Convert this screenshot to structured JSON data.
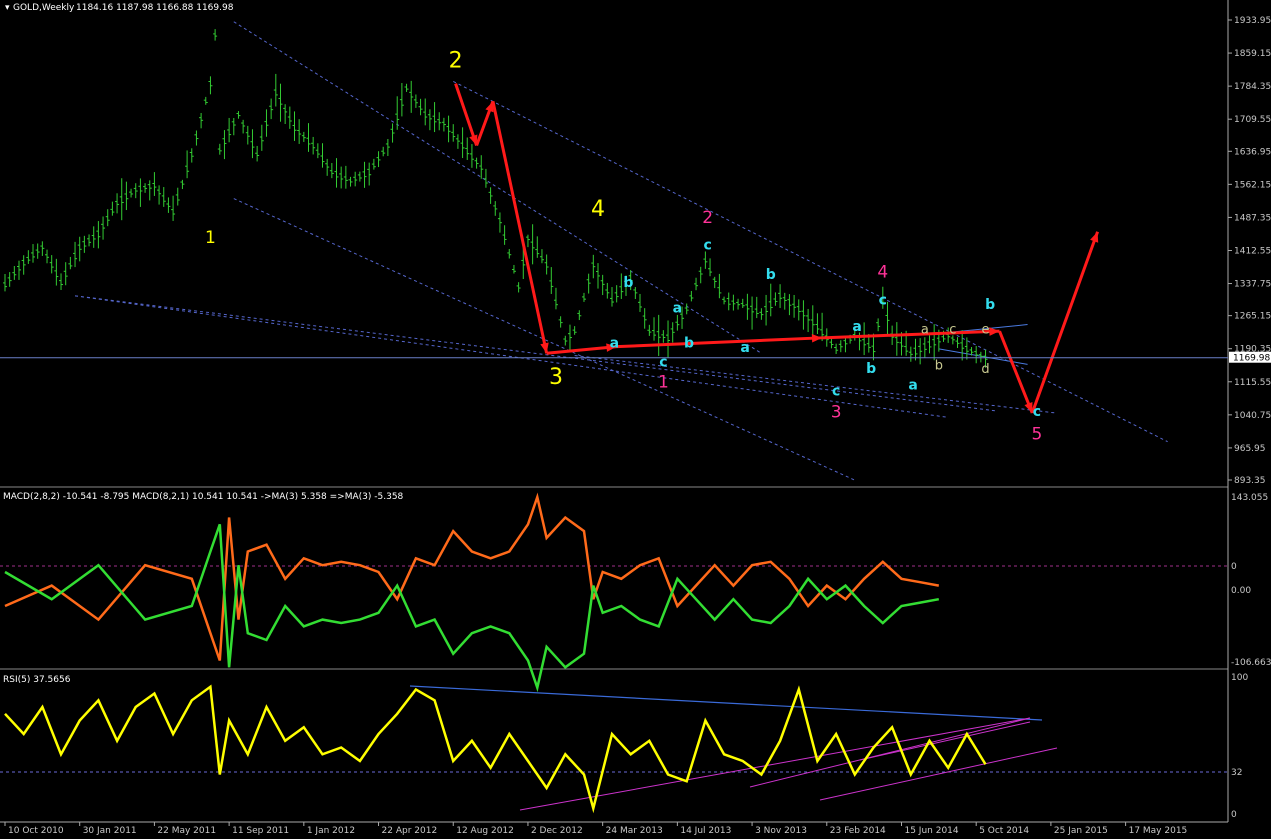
{
  "main_panel": {
    "symbol_header": "GOLD,Weekly",
    "ohlc": "1184.16 1187.98 1166.88 1169.98",
    "current_price": "1169.98",
    "y_ticks": [
      "1933.95",
      "1859.15",
      "1784.35",
      "1709.55",
      "1636.95",
      "1562.15",
      "1487.35",
      "1412.55",
      "1337.75",
      "1265.15",
      "1190.35",
      "1115.55",
      "1040.75",
      "965.95",
      "893.35"
    ]
  },
  "macd_panel": {
    "header": "MACD(2,8,2) -10.541 -8.795  MACD(8,2,1) 10.541 10.541  ->MA(3) 5.358  =>MA(3) -5.358",
    "y_ticks": [
      "143.055",
      "0",
      "0.00",
      "-106.663"
    ]
  },
  "rsi_panel": {
    "header": "RSI(5) 37.5656",
    "y_ticks": [
      "100",
      "32",
      "0"
    ]
  },
  "x_dates": [
    "10 Oct 2010",
    "30 Jan 2011",
    "22 May 2011",
    "11 Sep 2011",
    "1 Jan 2012",
    "22 Apr 2012",
    "12 Aug 2012",
    "2 Dec 2012",
    "24 Mar 2013",
    "14 Jul 2013",
    "3 Nov 2013",
    "23 Feb 2014",
    "15 Jun 2014",
    "5 Oct 2014",
    "25 Jan 2015",
    "17 May 2015"
  ],
  "wave_labels": [
    {
      "t": "2",
      "c": "#ffff00",
      "s": "lg",
      "x": 96.5,
      "y": 1827
    },
    {
      "t": "1",
      "c": "#ffff00",
      "s": "md",
      "x": 44,
      "y": 1430
    },
    {
      "t": "4",
      "c": "#ffff00",
      "s": "lg",
      "x": 127,
      "y": 1490
    },
    {
      "t": "3",
      "c": "#ffff00",
      "s": "lg",
      "x": 118,
      "y": 1110
    },
    {
      "t": "2",
      "c": "#ff3399",
      "s": "md",
      "x": 150.5,
      "y": 1475
    },
    {
      "t": "c",
      "c": "#33ddee",
      "s": "sm",
      "x": 150.5,
      "y": 1415
    },
    {
      "t": "b",
      "c": "#33ddee",
      "s": "sm",
      "x": 133.5,
      "y": 1330
    },
    {
      "t": "a",
      "c": "#33ddee",
      "s": "sm",
      "x": 144,
      "y": 1272
    },
    {
      "t": "a",
      "c": "#33ddee",
      "s": "sm",
      "x": 130.5,
      "y": 1193
    },
    {
      "t": "b",
      "c": "#33ddee",
      "s": "sm",
      "x": 146.5,
      "y": 1193
    },
    {
      "t": "a",
      "c": "#33ddee",
      "s": "sm",
      "x": 158.5,
      "y": 1183
    },
    {
      "t": "c",
      "c": "#33ddee",
      "s": "sm",
      "x": 141,
      "y": 1150
    },
    {
      "t": "1",
      "c": "#ff3399",
      "s": "md",
      "x": 141,
      "y": 1103
    },
    {
      "t": "b",
      "c": "#33ddee",
      "s": "sm",
      "x": 164,
      "y": 1348
    },
    {
      "t": "4",
      "c": "#ff3399",
      "s": "md",
      "x": 188,
      "y": 1352
    },
    {
      "t": "c",
      "c": "#33ddee",
      "s": "sm",
      "x": 188,
      "y": 1290
    },
    {
      "t": "a",
      "c": "#33ddee",
      "s": "sm",
      "x": 182.5,
      "y": 1230
    },
    {
      "t": "b",
      "c": "#33ddee",
      "s": "sm",
      "x": 185.5,
      "y": 1135
    },
    {
      "t": "c",
      "c": "#33ddee",
      "s": "sm",
      "x": 178,
      "y": 1085
    },
    {
      "t": "3",
      "c": "#ff3399",
      "s": "md",
      "x": 178,
      "y": 1035
    },
    {
      "t": "a",
      "c": "#33ddee",
      "s": "sm",
      "x": 194.5,
      "y": 1098
    },
    {
      "t": "a",
      "c": "#c8c890",
      "s": "xs",
      "x": 197,
      "y": 1225
    },
    {
      "t": "c",
      "c": "#c8c890",
      "s": "xs",
      "x": 203,
      "y": 1225
    },
    {
      "t": "e",
      "c": "#c8c890",
      "s": "xs",
      "x": 210,
      "y": 1225
    },
    {
      "t": "b",
      "c": "#c8c890",
      "s": "xs",
      "x": 200,
      "y": 1143
    },
    {
      "t": "d",
      "c": "#c8c890",
      "s": "xs",
      "x": 210,
      "y": 1135
    },
    {
      "t": "b",
      "c": "#33ddee",
      "s": "sm",
      "x": 211,
      "y": 1280
    },
    {
      "t": "c",
      "c": "#33ddee",
      "s": "sm",
      "x": 221,
      "y": 1038
    },
    {
      "t": "5",
      "c": "#ff3399",
      "s": "md",
      "x": 221,
      "y": 985
    }
  ],
  "chart_data": {
    "type": "line",
    "title": "GOLD,Weekly",
    "x_unit": "weeks since 10 Oct 2010",
    "price_series": [
      [
        0,
        1335
      ],
      [
        4,
        1385
      ],
      [
        8,
        1420
      ],
      [
        12,
        1340
      ],
      [
        16,
        1420
      ],
      [
        20,
        1450
      ],
      [
        24,
        1520
      ],
      [
        28,
        1550
      ],
      [
        32,
        1560
      ],
      [
        36,
        1500
      ],
      [
        40,
        1630
      ],
      [
        44,
        1790
      ],
      [
        45,
        1900
      ],
      [
        46,
        1640
      ],
      [
        50,
        1720
      ],
      [
        54,
        1630
      ],
      [
        58,
        1770
      ],
      [
        62,
        1690
      ],
      [
        66,
        1650
      ],
      [
        70,
        1590
      ],
      [
        74,
        1570
      ],
      [
        78,
        1590
      ],
      [
        82,
        1650
      ],
      [
        86,
        1780
      ],
      [
        90,
        1720
      ],
      [
        94,
        1700
      ],
      [
        98,
        1650
      ],
      [
        102,
        1600
      ],
      [
        106,
        1480
      ],
      [
        110,
        1330
      ],
      [
        112,
        1440
      ],
      [
        116,
        1380
      ],
      [
        120,
        1210
      ],
      [
        122,
        1230
      ],
      [
        126,
        1380
      ],
      [
        130,
        1300
      ],
      [
        134,
        1350
      ],
      [
        138,
        1230
      ],
      [
        142,
        1215
      ],
      [
        146,
        1280
      ],
      [
        150,
        1390
      ],
      [
        154,
        1300
      ],
      [
        158,
        1290
      ],
      [
        162,
        1270
      ],
      [
        166,
        1310
      ],
      [
        170,
        1280
      ],
      [
        174,
        1240
      ],
      [
        178,
        1190
      ],
      [
        182,
        1220
      ],
      [
        186,
        1190
      ],
      [
        188,
        1300
      ],
      [
        190,
        1220
      ],
      [
        194,
        1180
      ],
      [
        198,
        1200
      ],
      [
        202,
        1220
      ],
      [
        206,
        1190
      ],
      [
        210,
        1170
      ]
    ],
    "price_labels": [
      {
        "x": 0,
        "text": "10 Oct 2010"
      },
      {
        "x": 16,
        "text": "30 Jan 2011"
      },
      {
        "x": 32,
        "text": "22 May 2011"
      },
      {
        "x": 48,
        "text": "11 Sep 2011"
      },
      {
        "x": 64,
        "text": "1 Jan 2012"
      },
      {
        "x": 80,
        "text": "22 Apr 2012"
      },
      {
        "x": 96,
        "text": "12 Aug 2012"
      },
      {
        "x": 112,
        "text": "2 Dec 2012"
      },
      {
        "x": 128,
        "text": "24 Mar 2013"
      },
      {
        "x": 144,
        "text": "14 Jul 2013"
      },
      {
        "x": 160,
        "text": "3 Nov 2013"
      },
      {
        "x": 176,
        "text": "23 Feb 2014"
      },
      {
        "x": 192,
        "text": "15 Jun 2014"
      },
      {
        "x": 208,
        "text": "5 Oct 2014"
      },
      {
        "x": 224,
        "text": "25 Jan 2015"
      },
      {
        "x": 240,
        "text": "17 May 2015"
      }
    ],
    "y_range": [
      893.35,
      1933.95
    ],
    "wave_path": [
      [
        96.5,
        1790
      ],
      [
        101,
        1650
      ],
      [
        104.5,
        1750
      ],
      [
        116,
        1180
      ],
      [
        131,
        1195
      ],
      [
        175,
        1215
      ],
      [
        213,
        1230
      ],
      [
        220,
        1045
      ],
      [
        234,
        1455
      ]
    ],
    "trendlines_price": [
      [
        [
          49,
          1930
        ],
        [
          162,
          1180
        ]
      ],
      [
        [
          96,
          1795
        ],
        [
          249,
          980
        ]
      ],
      [
        [
          49,
          1530
        ],
        [
          182,
          893
        ]
      ],
      [
        [
          15,
          1310
        ],
        [
          212,
          1050
        ]
      ],
      [
        [
          15,
          1310
        ],
        [
          202,
          1035
        ]
      ],
      [
        [
          122,
          1175
        ],
        [
          225,
          1045
        ]
      ],
      [
        [
          200,
          1225
        ],
        [
          219,
          1245
        ]
      ],
      [
        [
          200,
          1190
        ],
        [
          219,
          1155
        ]
      ]
    ],
    "macd_range": [
      -106.663,
      143.055
    ],
    "macd_orange": [
      [
        0,
        -20
      ],
      [
        10,
        10
      ],
      [
        20,
        -40
      ],
      [
        30,
        40
      ],
      [
        40,
        20
      ],
      [
        44,
        -60
      ],
      [
        46,
        -100
      ],
      [
        48,
        110
      ],
      [
        50,
        -40
      ],
      [
        52,
        60
      ],
      [
        56,
        70
      ],
      [
        60,
        20
      ],
      [
        64,
        50
      ],
      [
        68,
        40
      ],
      [
        72,
        45
      ],
      [
        76,
        40
      ],
      [
        80,
        30
      ],
      [
        84,
        -10
      ],
      [
        88,
        50
      ],
      [
        92,
        40
      ],
      [
        96,
        90
      ],
      [
        100,
        60
      ],
      [
        104,
        50
      ],
      [
        108,
        60
      ],
      [
        112,
        100
      ],
      [
        114,
        140
      ],
      [
        116,
        80
      ],
      [
        120,
        110
      ],
      [
        124,
        90
      ],
      [
        126,
        -10
      ],
      [
        128,
        30
      ],
      [
        132,
        20
      ],
      [
        136,
        40
      ],
      [
        140,
        50
      ],
      [
        144,
        -20
      ],
      [
        148,
        10
      ],
      [
        152,
        40
      ],
      [
        156,
        10
      ],
      [
        160,
        40
      ],
      [
        164,
        45
      ],
      [
        168,
        20
      ],
      [
        172,
        -20
      ],
      [
        176,
        10
      ],
      [
        180,
        -10
      ],
      [
        184,
        20
      ],
      [
        188,
        45
      ],
      [
        192,
        20
      ],
      [
        196,
        15
      ],
      [
        200,
        10
      ]
    ],
    "macd_green": [
      [
        0,
        30
      ],
      [
        10,
        -10
      ],
      [
        20,
        40
      ],
      [
        30,
        -40
      ],
      [
        40,
        -20
      ],
      [
        44,
        60
      ],
      [
        46,
        100
      ],
      [
        48,
        -110
      ],
      [
        50,
        40
      ],
      [
        52,
        -60
      ],
      [
        56,
        -70
      ],
      [
        60,
        -20
      ],
      [
        64,
        -50
      ],
      [
        68,
        -40
      ],
      [
        72,
        -45
      ],
      [
        76,
        -40
      ],
      [
        80,
        -30
      ],
      [
        84,
        10
      ],
      [
        88,
        -50
      ],
      [
        92,
        -40
      ],
      [
        96,
        -90
      ],
      [
        100,
        -60
      ],
      [
        104,
        -50
      ],
      [
        108,
        -60
      ],
      [
        112,
        -100
      ],
      [
        114,
        -140
      ],
      [
        116,
        -80
      ],
      [
        120,
        -110
      ],
      [
        124,
        -90
      ],
      [
        126,
        10
      ],
      [
        128,
        -30
      ],
      [
        132,
        -20
      ],
      [
        136,
        -40
      ],
      [
        140,
        -50
      ],
      [
        144,
        20
      ],
      [
        148,
        -10
      ],
      [
        152,
        -40
      ],
      [
        156,
        -10
      ],
      [
        160,
        -40
      ],
      [
        164,
        -45
      ],
      [
        168,
        -20
      ],
      [
        172,
        20
      ],
      [
        176,
        -10
      ],
      [
        180,
        10
      ],
      [
        184,
        -20
      ],
      [
        188,
        -45
      ],
      [
        192,
        -20
      ],
      [
        196,
        -15
      ],
      [
        200,
        -10
      ]
    ],
    "rsi_range": [
      0,
      100
    ],
    "rsi": [
      [
        0,
        75
      ],
      [
        4,
        60
      ],
      [
        8,
        80
      ],
      [
        12,
        45
      ],
      [
        16,
        70
      ],
      [
        20,
        85
      ],
      [
        24,
        55
      ],
      [
        28,
        80
      ],
      [
        32,
        90
      ],
      [
        36,
        60
      ],
      [
        40,
        85
      ],
      [
        44,
        95
      ],
      [
        46,
        30
      ],
      [
        48,
        70
      ],
      [
        52,
        45
      ],
      [
        56,
        80
      ],
      [
        60,
        55
      ],
      [
        64,
        65
      ],
      [
        68,
        45
      ],
      [
        72,
        50
      ],
      [
        76,
        40
      ],
      [
        80,
        60
      ],
      [
        84,
        75
      ],
      [
        88,
        93
      ],
      [
        92,
        85
      ],
      [
        96,
        40
      ],
      [
        100,
        55
      ],
      [
        104,
        35
      ],
      [
        108,
        60
      ],
      [
        112,
        40
      ],
      [
        116,
        20
      ],
      [
        120,
        45
      ],
      [
        124,
        30
      ],
      [
        126,
        5
      ],
      [
        130,
        60
      ],
      [
        134,
        45
      ],
      [
        138,
        55
      ],
      [
        142,
        30
      ],
      [
        146,
        25
      ],
      [
        150,
        70
      ],
      [
        154,
        45
      ],
      [
        158,
        40
      ],
      [
        162,
        30
      ],
      [
        166,
        55
      ],
      [
        170,
        93
      ],
      [
        174,
        40
      ],
      [
        178,
        60
      ],
      [
        182,
        30
      ],
      [
        186,
        50
      ],
      [
        190,
        65
      ],
      [
        194,
        30
      ],
      [
        198,
        55
      ],
      [
        202,
        35
      ],
      [
        206,
        60
      ],
      [
        210,
        37.5656
      ]
    ]
  }
}
